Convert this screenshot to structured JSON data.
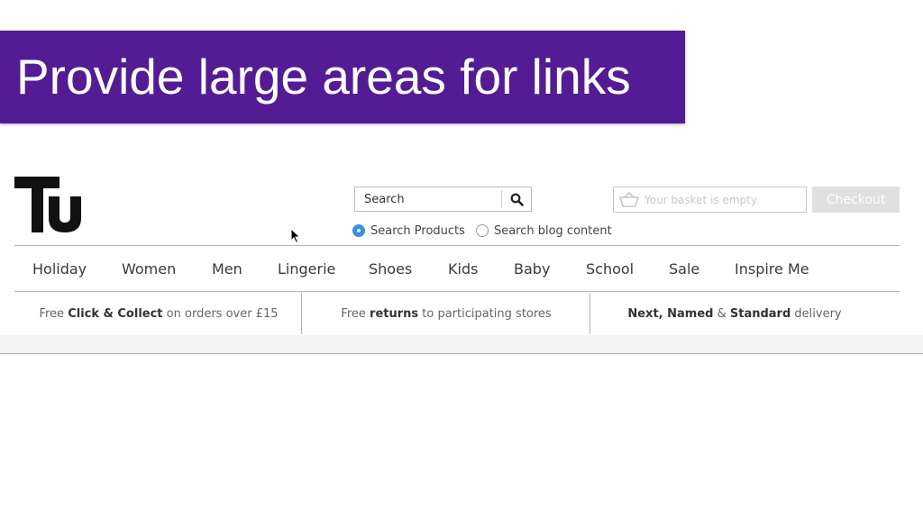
{
  "banner": {
    "title": "Provide large areas for links"
  },
  "logo": {
    "text": "Tu"
  },
  "search": {
    "placeholder": "Search",
    "options": [
      {
        "label": "Search Products",
        "checked": true
      },
      {
        "label": "Search blog content",
        "checked": false
      }
    ]
  },
  "basket": {
    "label": "Your basket is empty",
    "checkout_label": "Checkout"
  },
  "nav": {
    "items": [
      "Holiday",
      "Women",
      "Men",
      "Lingerie",
      "Shoes",
      "Kids",
      "Baby",
      "School",
      "Sale",
      "Inspire Me"
    ]
  },
  "promos": [
    {
      "pre": "Free ",
      "bold": "Click & Collect",
      "post": " on orders over £15"
    },
    {
      "pre": "Free ",
      "bold": "returns",
      "post": " to participating stores"
    },
    {
      "bold": "Next, Named",
      "mid": " & ",
      "bold2": "Standard",
      "post": " delivery"
    }
  ],
  "colors": {
    "banner": "#531c94",
    "radio_selected": "#3a8fe8",
    "checkout_disabled": "#e0e0e0"
  },
  "icons": [
    "tu-logo",
    "search-icon",
    "basket-icon",
    "mouse-cursor-icon"
  ]
}
